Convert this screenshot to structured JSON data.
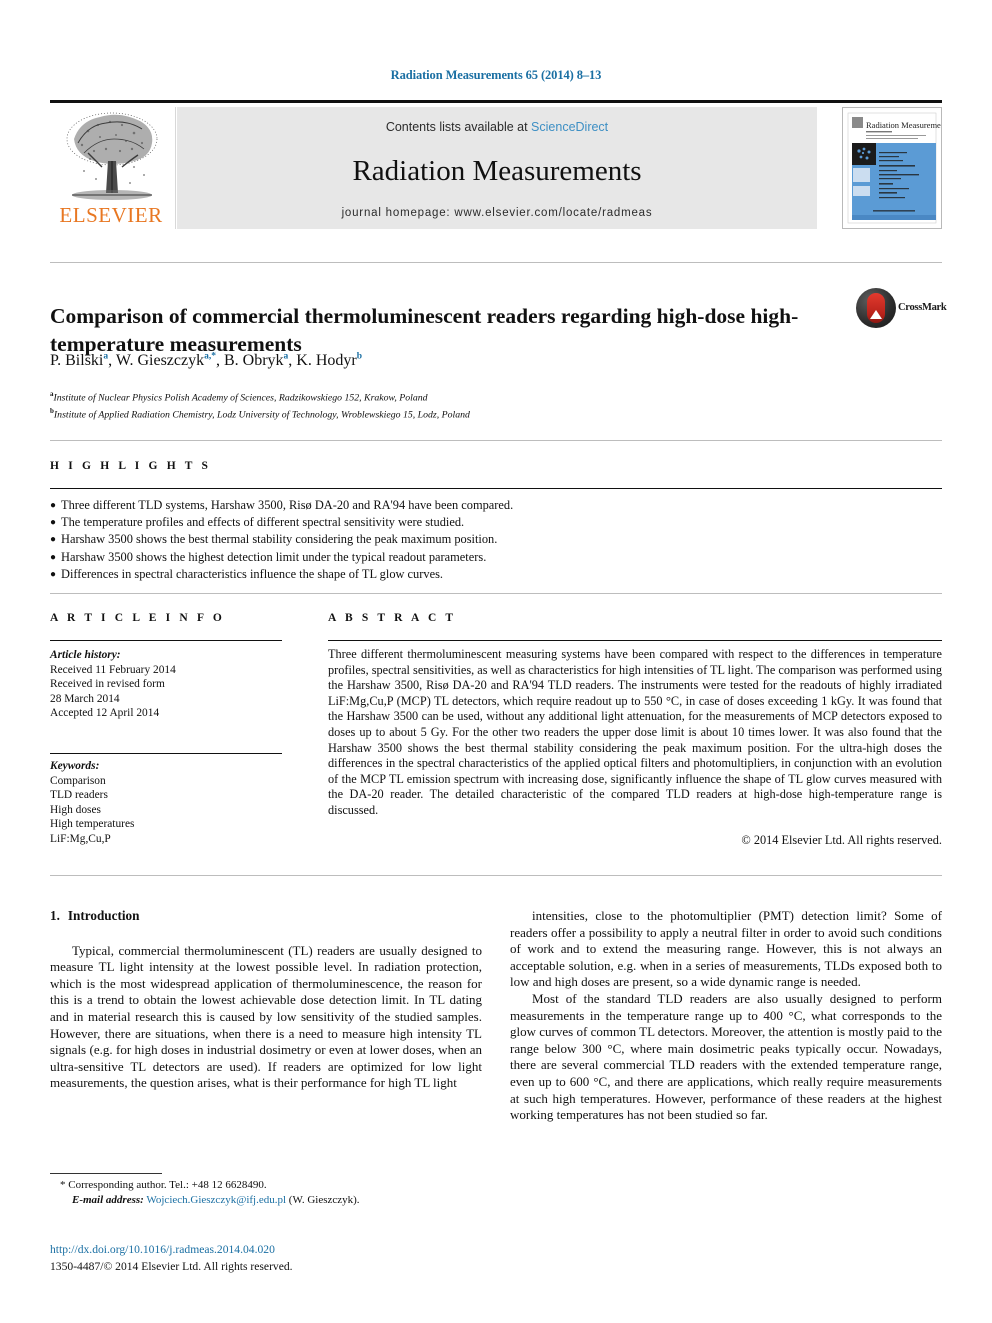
{
  "running_head": "Radiation Measurements 65 (2014) 8–13",
  "masthead": {
    "publisher_name": "ELSEVIER",
    "contents_prefix": "Contents lists available at ",
    "contents_link": "ScienceDirect",
    "journal_title": "Radiation Measurements",
    "homepage": "journal homepage: www.elsevier.com/locate/radmeas",
    "cover_title": "Radiation Measurements"
  },
  "article": {
    "title": "Comparison of commercial thermoluminescent readers regarding high-dose high-temperature measurements",
    "crossmark_label": "CrossMark",
    "authors": [
      {
        "name": "P. Bilski",
        "sup": "a",
        "sep": ", "
      },
      {
        "name": "W. Gieszczyk",
        "sup": "a,*",
        "sep": ", "
      },
      {
        "name": "B. Obryk",
        "sup": "a",
        "sep": ", "
      },
      {
        "name": "K. Hodyr",
        "sup": "b",
        "sep": ""
      }
    ],
    "affiliations": [
      {
        "mark": "a",
        "text": "Institute of Nuclear Physics Polish Academy of Sciences, Radzikowskiego 152, Krakow, Poland"
      },
      {
        "mark": "b",
        "text": "Institute of Applied Radiation Chemistry, Lodz University of Technology, Wroblewskiego 15, Lodz, Poland"
      }
    ]
  },
  "highlights": {
    "heading": "H I G H L I G H T S",
    "items": [
      "Three different TLD systems, Harshaw 3500, Risø DA-20 and RA'94 have been compared.",
      "The temperature profiles and effects of different spectral sensitivity were studied.",
      "Harshaw 3500 shows the best thermal stability considering the peak maximum position.",
      "Harshaw 3500 shows the highest detection limit under the typical readout parameters.",
      "Differences in spectral characteristics influence the shape of TL glow curves."
    ]
  },
  "article_info": {
    "heading": "A R T I C L E   I N F O",
    "history_label": "Article history:",
    "history": [
      "Received 11 February 2014",
      "Received in revised form",
      "28 March 2014",
      "Accepted 12 April 2014"
    ],
    "keywords_label": "Keywords:",
    "keywords": [
      "Comparison",
      "TLD readers",
      "High doses",
      "High temperatures",
      "LiF:Mg,Cu,P"
    ]
  },
  "abstract": {
    "heading": "A B S T R A C T",
    "text": "Three different thermoluminescent measuring systems have been compared with respect to the differences in temperature profiles, spectral sensitivities, as well as characteristics for high intensities of TL light. The comparison was performed using the Harshaw 3500, Risø DA-20 and RA'94 TLD readers. The instruments were tested for the readouts of highly irradiated LiF:Mg,Cu,P (MCP) TL detectors, which require readout up to 550 °C, in case of doses exceeding 1 kGy. It was found that the Harshaw 3500 can be used, without any additional light attenuation, for the measurements of MCP detectors exposed to doses up to about 5 Gy. For the other two readers the upper dose limit is about 10 times lower. It was also found that the Harshaw 3500 shows the best thermal stability considering the peak maximum position. For the ultra-high doses the differences in the spectral characteristics of the applied optical filters and photomultipliers, in conjunction with an evolution of the MCP TL emission spectrum with increasing dose, significantly influence the shape of TL glow curves measured with the DA-20 reader. The detailed characteristic of the compared TLD readers at high-dose high-temperature range is discussed.",
    "copyright": "© 2014 Elsevier Ltd. All rights reserved."
  },
  "body": {
    "section_number": "1.",
    "section_title": "Introduction",
    "left_paragraphs": [
      "Typical, commercial thermoluminescent (TL) readers are usually designed to measure TL light intensity at the lowest possible level. In radiation protection, which is the most widespread application of thermoluminescence, the reason for this is a trend to obtain the lowest achievable dose detection limit. In TL dating and in material research this is caused by low sensitivity of the studied samples. However, there are situations, when there is a need to measure high intensity TL signals (e.g. for high doses in industrial dosimetry or even at lower doses, when an ultra-sensitive TL detectors are used). If readers are optimized for low light measurements, the question arises, what is their performance for high TL light"
    ],
    "right_paragraphs": [
      "intensities, close to the photomultiplier (PMT) detection limit? Some of readers offer a possibility to apply a neutral filter in order to avoid such conditions of work and to extend the measuring range. However, this is not always an acceptable solution, e.g. when in a series of measurements, TLDs exposed both to low and high doses are present, so a wide dynamic range is needed.",
      "Most of the standard TLD readers are also usually designed to perform measurements in the temperature range up to 400 °C, what corresponds to the glow curves of common TL detectors. Moreover, the attention is mostly paid to the range below 300 °C, where main dosimetric peaks typically occur. Nowadays, there are several commercial TLD readers with the extended temperature range, even up to 600 °C, and there are applications, which really require measurements at such high temperatures. However, performance of these readers at the highest working temperatures has not been studied so far."
    ]
  },
  "footnote": {
    "corresponding": "* Corresponding author. Tel.: +48 12 6628490.",
    "email_label": "E-mail address:",
    "email": "Wojciech.Gieszczyk@ifj.edu.pl",
    "email_suffix": "(W. Gieszczyk).",
    "doi": "http://dx.doi.org/10.1016/j.radmeas.2014.04.020",
    "issn": "1350-4487/© 2014 Elsevier Ltd. All rights reserved."
  },
  "colors": {
    "link_blue": "#1a6fa3",
    "sciencedirect_blue": "#3d8fc4",
    "elsevier_orange": "#e87722",
    "cover_blue": "#5b9bd5"
  }
}
